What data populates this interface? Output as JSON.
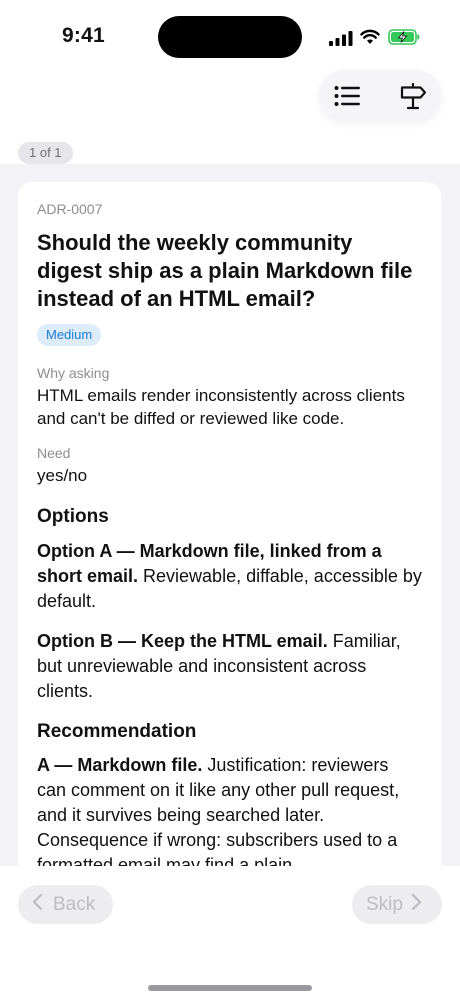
{
  "status_bar": {
    "time": "9:41"
  },
  "page_counter": "1 of 1",
  "card": {
    "id": "ADR-0007",
    "question": "Should the weekly community digest ship as a plain Markdown file instead of an HTML email?",
    "priority": "Medium",
    "why_label": "Why asking",
    "why_text": "HTML emails render inconsistently across clients and can't be diffed or reviewed like code.",
    "need_label": "Need",
    "need_text": "yes/no",
    "options_heading": "Options",
    "options": [
      {
        "title": "Option A — Markdown file, linked from a short email.",
        "text": " Reviewable, diffable, accessible by default."
      },
      {
        "title": "Option B — Keep the HTML email.",
        "text": " Familiar, but unreviewable and inconsistent across clients."
      }
    ],
    "recommendation_heading": "Recommendation",
    "recommendation_title": "A — Markdown file.",
    "recommendation_text": " Justification: reviewers can comment on it like any other pull request, and it survives being searched later. Consequence if wrong: subscribers used to a formatted email may find a plain"
  },
  "nav": {
    "back_label": "Back",
    "skip_label": "Skip"
  },
  "colors": {
    "accent": "#1f7bd6",
    "badge_bg": "#dcecfb",
    "battery_green": "#34c759"
  }
}
